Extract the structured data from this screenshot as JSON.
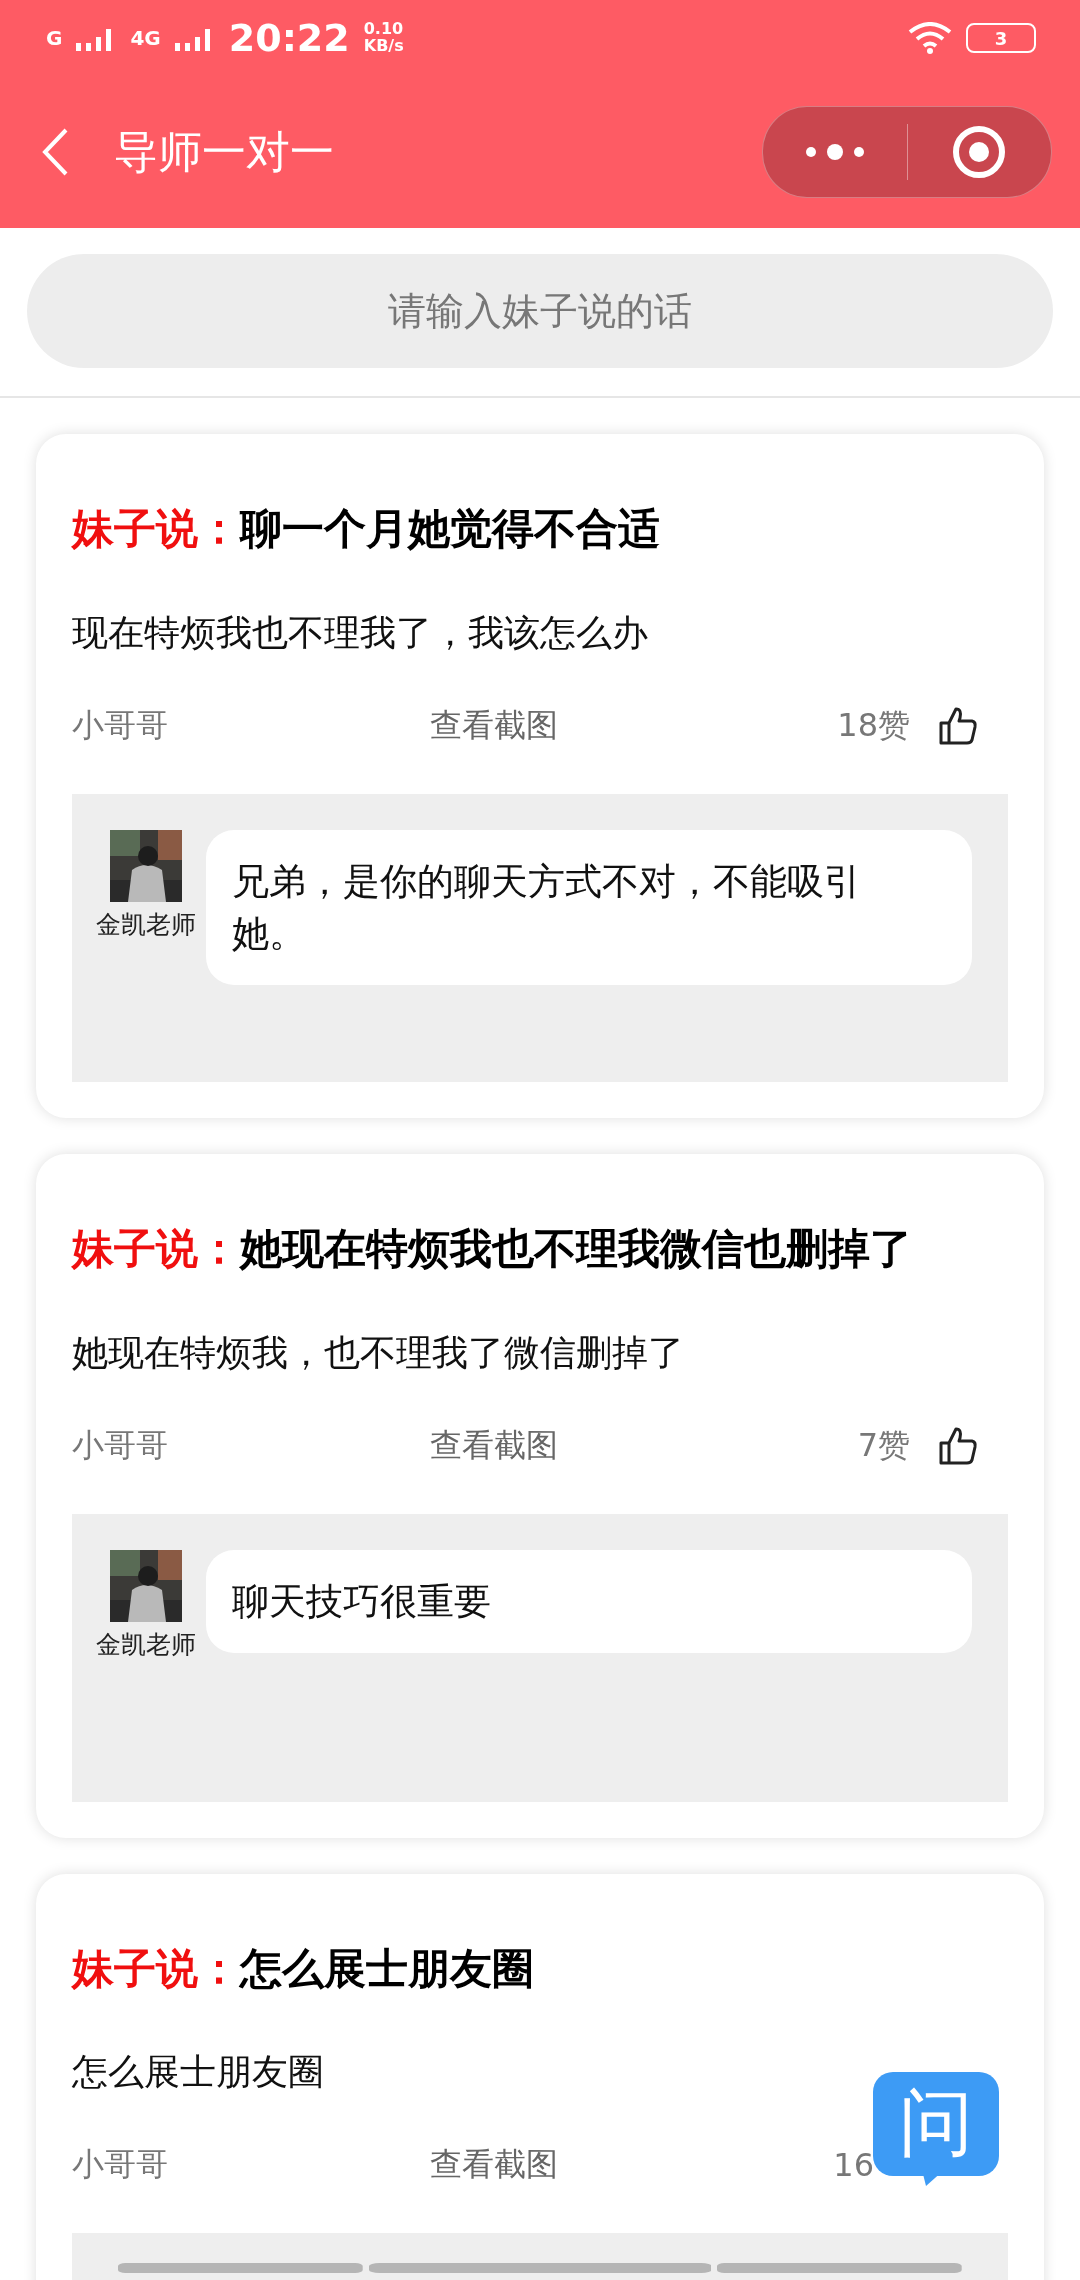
{
  "status_bar": {
    "signal_1": "G",
    "signal_2": "4G",
    "time": "20:22",
    "speed_value": "0.10",
    "speed_unit": "KB/s",
    "battery": "3"
  },
  "header": {
    "title": "导师一对一"
  },
  "search": {
    "placeholder": "请输入妹子说的话"
  },
  "posts": [
    {
      "prefix": "妹子说：",
      "title": "聊一个月她觉得不合适",
      "body": "现在特烦我也不理我了，我该怎么办",
      "author": "小哥哥",
      "link": "查看截图",
      "likes": "18赞",
      "like_icon": true,
      "reply": {
        "teacher": "金凯老师",
        "text": "兄弟，是你的聊天方式不对，不能吸引她。"
      }
    },
    {
      "prefix": "妹子说：",
      "title": "她现在特烦我也不理我微信也删掉了",
      "body": "她现在特烦我，也不理我了微信删掉了",
      "author": "小哥哥",
      "link": "查看截图",
      "likes": "7赞",
      "like_icon": true,
      "reply": {
        "teacher": "金凯老师",
        "text": "聊天技巧很重要"
      }
    },
    {
      "prefix": "妹子说：",
      "title": "怎么展士朋友圈",
      "body": "怎么展士朋友圈",
      "author": "小哥哥",
      "link": "查看截图",
      "likes": "16",
      "like_icon": false
    }
  ],
  "float_button": {
    "label": "问"
  }
}
